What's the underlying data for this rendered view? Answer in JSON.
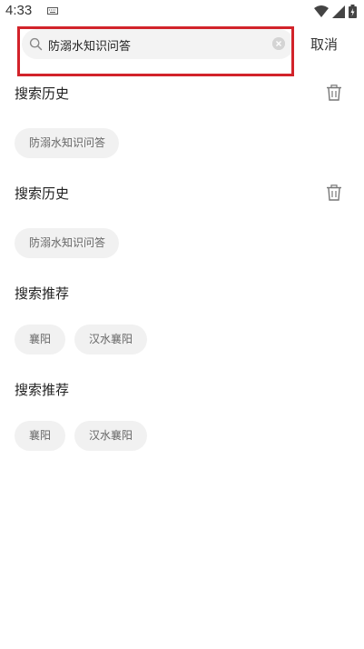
{
  "status_bar": {
    "time": "4:33"
  },
  "search": {
    "value": "防溺水知识问答",
    "cancel_label": "取消"
  },
  "sections": [
    {
      "title": "搜索历史",
      "chips": [
        "防溺水知识问答"
      ],
      "has_delete": true
    },
    {
      "title": "搜索历史",
      "chips": [
        "防溺水知识问答"
      ],
      "has_delete": true
    },
    {
      "title": "搜索推荐",
      "chips": [
        "襄阳",
        "汉水襄阳"
      ],
      "has_delete": false
    },
    {
      "title": "搜索推荐",
      "chips": [
        "襄阳",
        "汉水襄阳"
      ],
      "has_delete": false
    }
  ]
}
